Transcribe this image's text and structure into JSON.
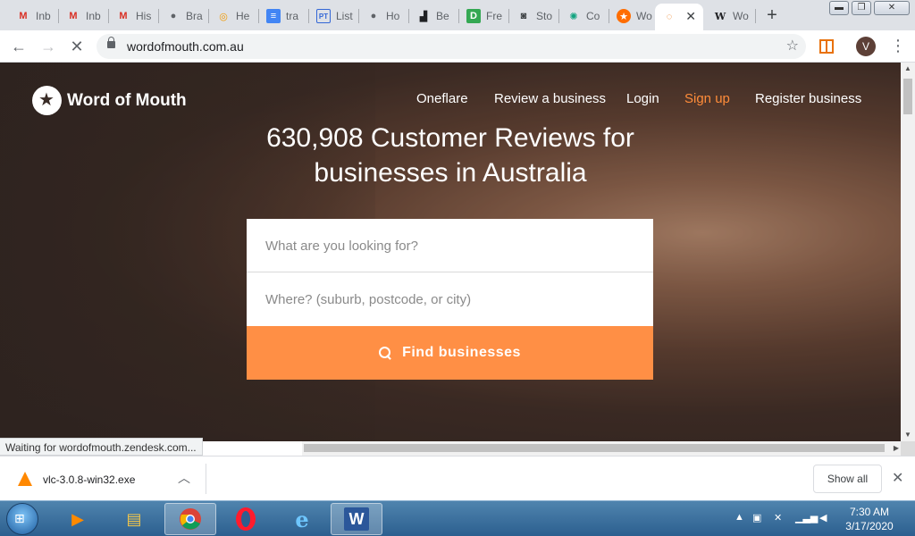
{
  "browser": {
    "tabs": [
      {
        "label": "Inb",
        "icon": "gmail-icon",
        "glyph": "M",
        "color": "#d93025"
      },
      {
        "label": "Inb",
        "icon": "gmail-icon",
        "glyph": "M",
        "color": "#d93025"
      },
      {
        "label": "His",
        "icon": "gmail-icon",
        "glyph": "M",
        "color": "#d93025"
      },
      {
        "label": "Bra",
        "icon": "globe-icon",
        "glyph": "●",
        "color": "#5f6368"
      },
      {
        "label": "He",
        "icon": "swirl-icon",
        "glyph": "◎",
        "color": "#f29900"
      },
      {
        "label": "tra",
        "icon": "docs-icon",
        "glyph": "≡",
        "color": "#4285f4"
      },
      {
        "label": "List",
        "icon": "pt-icon",
        "glyph": "PT",
        "color": "#3367d6"
      },
      {
        "label": "Ho",
        "icon": "globe-icon",
        "glyph": "●",
        "color": "#5f6368"
      },
      {
        "label": "Be",
        "icon": "building-icon",
        "glyph": "▟",
        "color": "#202124"
      },
      {
        "label": "Fre",
        "icon": "d-icon",
        "glyph": "D",
        "color": "#34a853"
      },
      {
        "label": "Sto",
        "icon": "camera-icon",
        "glyph": "◙",
        "color": "#3c4043"
      },
      {
        "label": "Co",
        "icon": "openai-icon",
        "glyph": "✺",
        "color": "#10a37f"
      },
      {
        "label": "Wo",
        "icon": "wom-icon",
        "glyph": "★",
        "color": "#ff6d00"
      },
      {
        "label": "",
        "icon": "loading-icon",
        "glyph": "◌",
        "color": "#e8710a",
        "active": true
      },
      {
        "label": "Wo",
        "icon": "wikipedia-icon",
        "glyph": "W",
        "color": "#202124"
      }
    ],
    "url": "wordofmouth.com.au",
    "profile_initial": "V",
    "status_text": "Waiting for wordofmouth.zendesk.com..."
  },
  "site": {
    "logo_text": "Word of Mouth",
    "nav": [
      "Oneflare",
      "Review a business",
      "Login",
      "Sign up",
      "Register business"
    ],
    "headline_line1": "630,908 Customer Reviews for",
    "headline_line2": "businesses in Australia",
    "what_placeholder": "What are you looking for?",
    "where_placeholder": "Where? (suburb, postcode, or city)",
    "find_label": "Find businesses",
    "accent": "#ff8f45"
  },
  "downloads": {
    "file_name": "vlc-3.0.8-win32.exe",
    "show_all": "Show all"
  },
  "taskbar": {
    "time": "7:30 AM",
    "date": "3/17/2020"
  }
}
